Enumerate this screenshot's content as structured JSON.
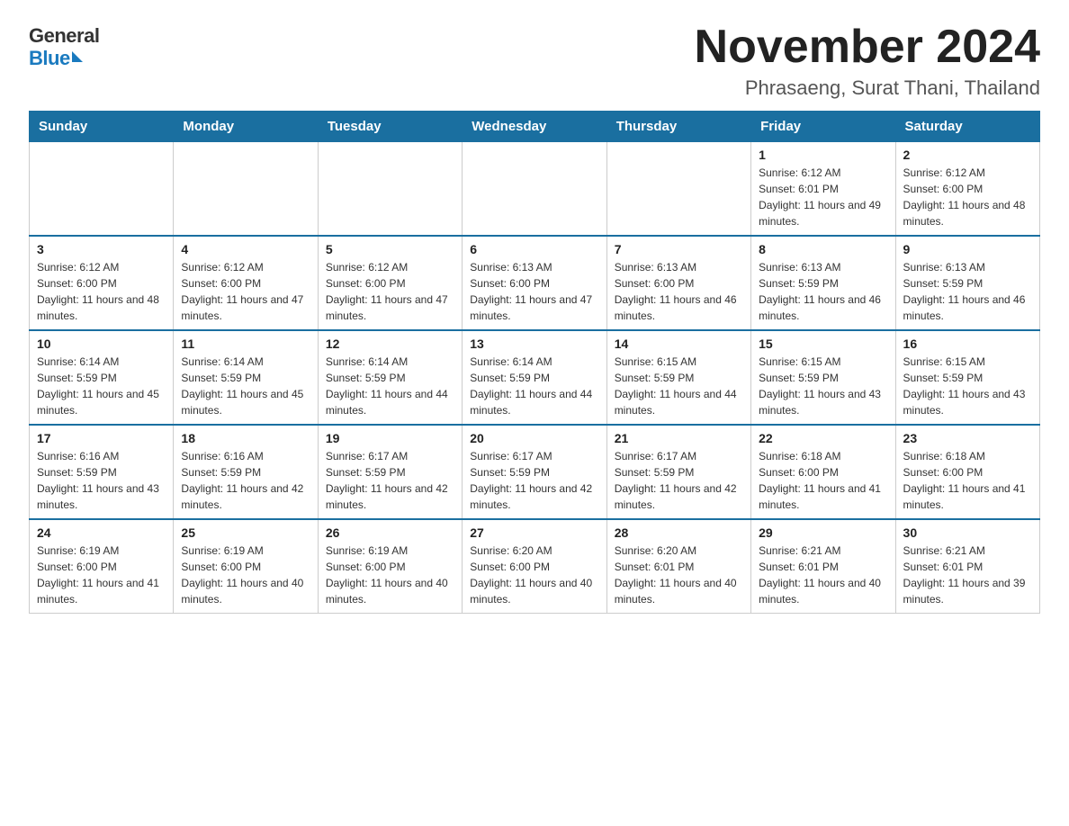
{
  "logo": {
    "general": "General",
    "blue": "Blue"
  },
  "title": "November 2024",
  "subtitle": "Phrasaeng, Surat Thani, Thailand",
  "days_of_week": [
    "Sunday",
    "Monday",
    "Tuesday",
    "Wednesday",
    "Thursday",
    "Friday",
    "Saturday"
  ],
  "weeks": [
    [
      {
        "day": "",
        "info": ""
      },
      {
        "day": "",
        "info": ""
      },
      {
        "day": "",
        "info": ""
      },
      {
        "day": "",
        "info": ""
      },
      {
        "day": "",
        "info": ""
      },
      {
        "day": "1",
        "info": "Sunrise: 6:12 AM\nSunset: 6:01 PM\nDaylight: 11 hours and 49 minutes."
      },
      {
        "day": "2",
        "info": "Sunrise: 6:12 AM\nSunset: 6:00 PM\nDaylight: 11 hours and 48 minutes."
      }
    ],
    [
      {
        "day": "3",
        "info": "Sunrise: 6:12 AM\nSunset: 6:00 PM\nDaylight: 11 hours and 48 minutes."
      },
      {
        "day": "4",
        "info": "Sunrise: 6:12 AM\nSunset: 6:00 PM\nDaylight: 11 hours and 47 minutes."
      },
      {
        "day": "5",
        "info": "Sunrise: 6:12 AM\nSunset: 6:00 PM\nDaylight: 11 hours and 47 minutes."
      },
      {
        "day": "6",
        "info": "Sunrise: 6:13 AM\nSunset: 6:00 PM\nDaylight: 11 hours and 47 minutes."
      },
      {
        "day": "7",
        "info": "Sunrise: 6:13 AM\nSunset: 6:00 PM\nDaylight: 11 hours and 46 minutes."
      },
      {
        "day": "8",
        "info": "Sunrise: 6:13 AM\nSunset: 5:59 PM\nDaylight: 11 hours and 46 minutes."
      },
      {
        "day": "9",
        "info": "Sunrise: 6:13 AM\nSunset: 5:59 PM\nDaylight: 11 hours and 46 minutes."
      }
    ],
    [
      {
        "day": "10",
        "info": "Sunrise: 6:14 AM\nSunset: 5:59 PM\nDaylight: 11 hours and 45 minutes."
      },
      {
        "day": "11",
        "info": "Sunrise: 6:14 AM\nSunset: 5:59 PM\nDaylight: 11 hours and 45 minutes."
      },
      {
        "day": "12",
        "info": "Sunrise: 6:14 AM\nSunset: 5:59 PM\nDaylight: 11 hours and 44 minutes."
      },
      {
        "day": "13",
        "info": "Sunrise: 6:14 AM\nSunset: 5:59 PM\nDaylight: 11 hours and 44 minutes."
      },
      {
        "day": "14",
        "info": "Sunrise: 6:15 AM\nSunset: 5:59 PM\nDaylight: 11 hours and 44 minutes."
      },
      {
        "day": "15",
        "info": "Sunrise: 6:15 AM\nSunset: 5:59 PM\nDaylight: 11 hours and 43 minutes."
      },
      {
        "day": "16",
        "info": "Sunrise: 6:15 AM\nSunset: 5:59 PM\nDaylight: 11 hours and 43 minutes."
      }
    ],
    [
      {
        "day": "17",
        "info": "Sunrise: 6:16 AM\nSunset: 5:59 PM\nDaylight: 11 hours and 43 minutes."
      },
      {
        "day": "18",
        "info": "Sunrise: 6:16 AM\nSunset: 5:59 PM\nDaylight: 11 hours and 42 minutes."
      },
      {
        "day": "19",
        "info": "Sunrise: 6:17 AM\nSunset: 5:59 PM\nDaylight: 11 hours and 42 minutes."
      },
      {
        "day": "20",
        "info": "Sunrise: 6:17 AM\nSunset: 5:59 PM\nDaylight: 11 hours and 42 minutes."
      },
      {
        "day": "21",
        "info": "Sunrise: 6:17 AM\nSunset: 5:59 PM\nDaylight: 11 hours and 42 minutes."
      },
      {
        "day": "22",
        "info": "Sunrise: 6:18 AM\nSunset: 6:00 PM\nDaylight: 11 hours and 41 minutes."
      },
      {
        "day": "23",
        "info": "Sunrise: 6:18 AM\nSunset: 6:00 PM\nDaylight: 11 hours and 41 minutes."
      }
    ],
    [
      {
        "day": "24",
        "info": "Sunrise: 6:19 AM\nSunset: 6:00 PM\nDaylight: 11 hours and 41 minutes."
      },
      {
        "day": "25",
        "info": "Sunrise: 6:19 AM\nSunset: 6:00 PM\nDaylight: 11 hours and 40 minutes."
      },
      {
        "day": "26",
        "info": "Sunrise: 6:19 AM\nSunset: 6:00 PM\nDaylight: 11 hours and 40 minutes."
      },
      {
        "day": "27",
        "info": "Sunrise: 6:20 AM\nSunset: 6:00 PM\nDaylight: 11 hours and 40 minutes."
      },
      {
        "day": "28",
        "info": "Sunrise: 6:20 AM\nSunset: 6:01 PM\nDaylight: 11 hours and 40 minutes."
      },
      {
        "day": "29",
        "info": "Sunrise: 6:21 AM\nSunset: 6:01 PM\nDaylight: 11 hours and 40 minutes."
      },
      {
        "day": "30",
        "info": "Sunrise: 6:21 AM\nSunset: 6:01 PM\nDaylight: 11 hours and 39 minutes."
      }
    ]
  ]
}
